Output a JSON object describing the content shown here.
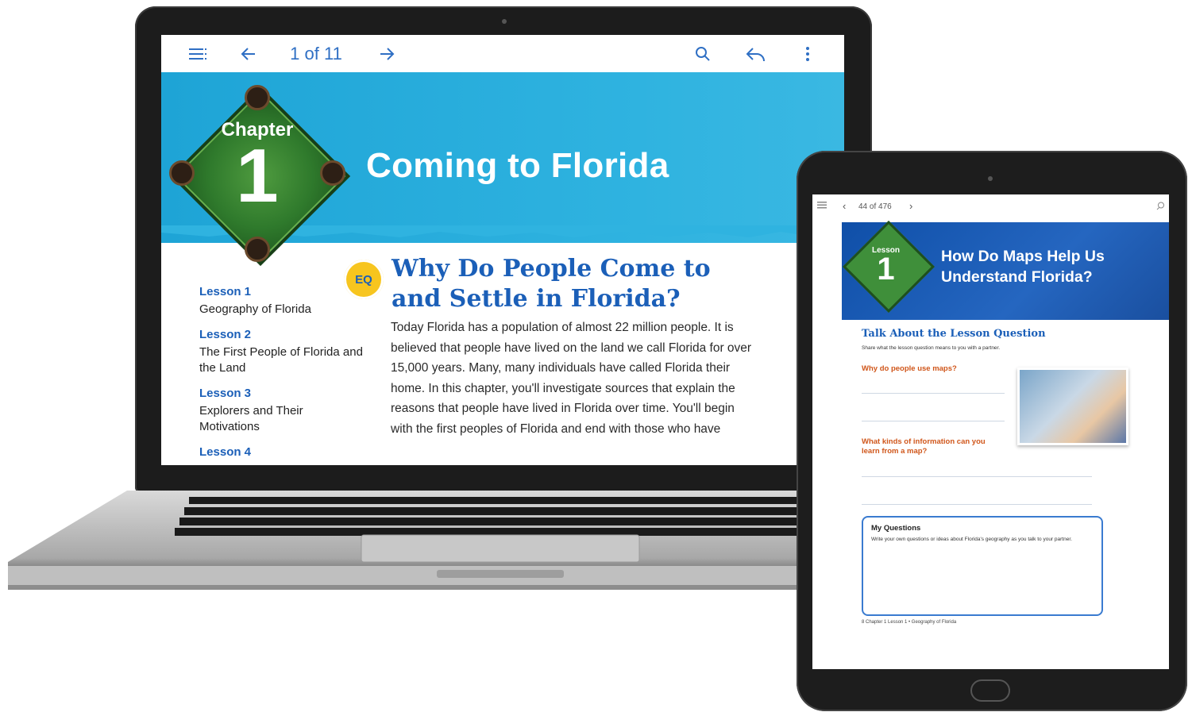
{
  "laptop": {
    "toolbar": {
      "menu_icon": "menu-icon",
      "prev_icon": "arrow-left-icon",
      "page_indicator": "1 of 11",
      "next_icon": "arrow-right-icon",
      "search_icon": "search-icon",
      "back_icon": "undo-icon",
      "more_icon": "more-vertical-icon"
    },
    "banner": {
      "badge_label": "Chapter",
      "badge_number": "1",
      "title": "Coming to Florida"
    },
    "lessons": [
      {
        "number": "Lesson 1",
        "name": "Geography of Florida"
      },
      {
        "number": "Lesson 2",
        "name": "The First People of Florida and the Land"
      },
      {
        "number": "Lesson 3",
        "name": "Explorers and Their Motivations"
      },
      {
        "number": "Lesson 4",
        "name": ""
      }
    ],
    "essential_question": {
      "badge": "EQ",
      "heading": "Why Do People Come to and Settle in Florida?",
      "body": "Today Florida has a population of almost 22 million people. It is believed that people have lived on the land we call Florida for over 15,000 years. Many, many individuals have called Florida their home. In this chapter, you'll investigate sources that explain the reasons that people have lived in Florida over time. You'll begin with the first peoples of Florida and end with those who have"
    }
  },
  "tablet": {
    "toolbar": {
      "menu_icon": "menu-icon",
      "prev_icon": "chevron-left-icon",
      "page_indicator": "44 of 476",
      "next_icon": "chevron-right-icon",
      "search_icon": "search-icon"
    },
    "banner": {
      "badge_label": "Lesson",
      "badge_number": "1",
      "title": "How Do Maps Help Us Understand Florida?"
    },
    "section_title": "Talk About the Lesson Question",
    "section_subtitle": "Share what the lesson question means to you with a partner.",
    "question_1": "Why do people use maps?",
    "question_2": "What kinds of information can you learn from a map?",
    "my_questions": {
      "title": "My Questions",
      "text": "Write your own questions or ideas about Florida's geography as you talk to your partner."
    },
    "footer": "8  Chapter 1 Lesson 1 • Geography of Florida"
  }
}
